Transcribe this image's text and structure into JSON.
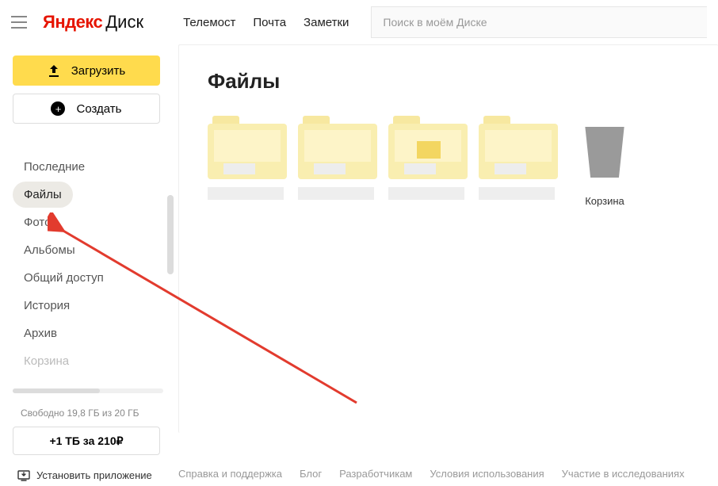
{
  "logo": {
    "brand": "Яндекс",
    "product": "Диск"
  },
  "topnav": [
    "Телемост",
    "Почта",
    "Заметки"
  ],
  "search": {
    "placeholder": "Поиск в моём Диске"
  },
  "sidebar": {
    "upload_label": "Загрузить",
    "create_label": "Создать",
    "items": [
      {
        "label": "Последние",
        "active": false
      },
      {
        "label": "Файлы",
        "active": true
      },
      {
        "label": "Фото",
        "active": false
      },
      {
        "label": "Альбомы",
        "active": false
      },
      {
        "label": "Общий доступ",
        "active": false
      },
      {
        "label": "История",
        "active": false
      },
      {
        "label": "Архив",
        "active": false
      },
      {
        "label": "Корзина",
        "active": false
      }
    ],
    "storage_text": "Свободно 19,8 ГБ из 20 ГБ",
    "upgrade_label": "+1 ТБ за 210₽",
    "install_label": "Установить приложение"
  },
  "main": {
    "title": "Файлы",
    "trash_label": "Корзина"
  },
  "footer": [
    "Справка и поддержка",
    "Блог",
    "Разработчикам",
    "Условия использования",
    "Участие в исследованиях"
  ]
}
